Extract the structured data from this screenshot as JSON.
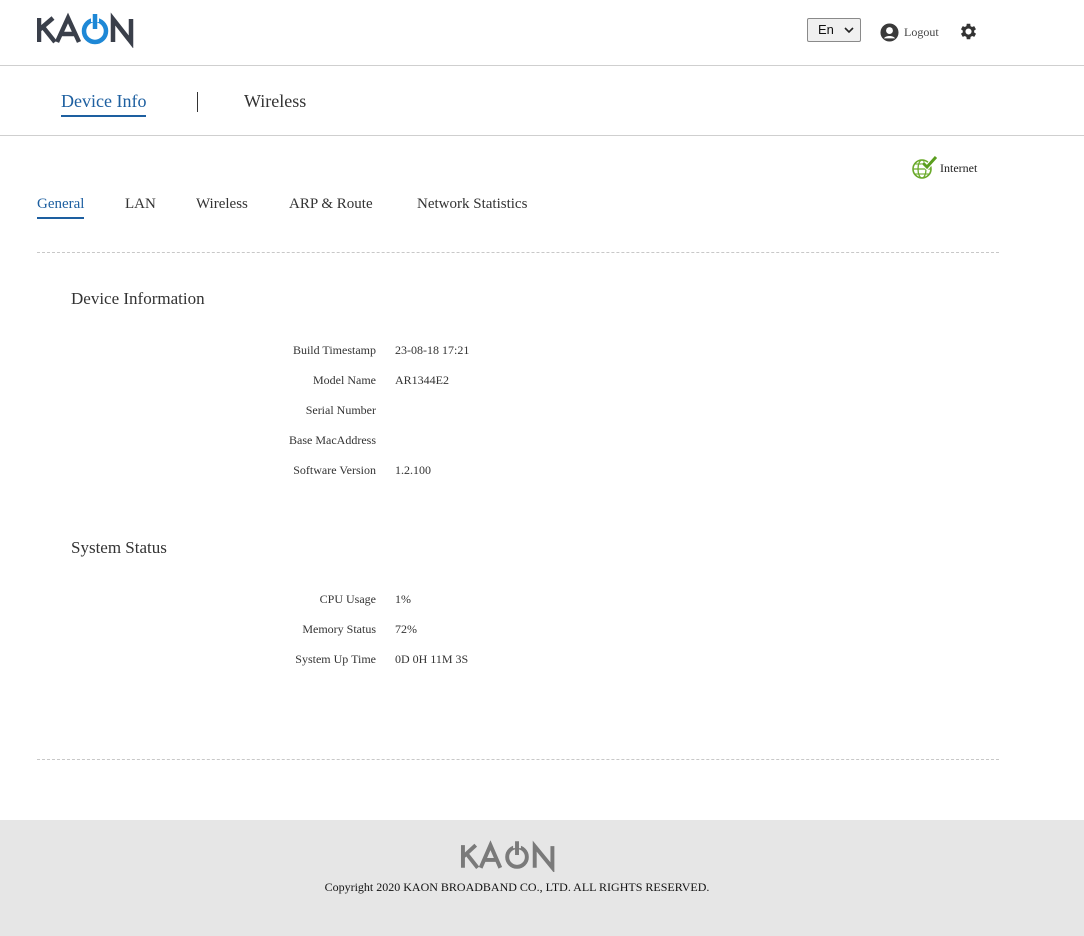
{
  "header": {
    "logo_text": "KAON",
    "language": {
      "selected": "En"
    },
    "logout_label": "Logout"
  },
  "main_tabs": [
    {
      "label": "Device Info",
      "active": true
    },
    {
      "label": "Wireless",
      "active": false
    }
  ],
  "internet_status": {
    "label": "Internet",
    "icon": "globe-check-icon",
    "color": "#6aaa2a"
  },
  "sub_tabs": [
    {
      "label": "General",
      "active": true
    },
    {
      "label": "LAN",
      "active": false
    },
    {
      "label": "Wireless",
      "active": false
    },
    {
      "label": "ARP & Route",
      "active": false
    },
    {
      "label": "Network Statistics",
      "active": false
    }
  ],
  "device_information": {
    "title": "Device Information",
    "rows": [
      {
        "label": "Build Timestamp",
        "value": "23-08-18 17:21"
      },
      {
        "label": "Model Name",
        "value": "AR1344E2"
      },
      {
        "label": "Serial Number",
        "value": ""
      },
      {
        "label": "Base MacAddress",
        "value": ""
      },
      {
        "label": "Software Version",
        "value": "1.2.100"
      }
    ]
  },
  "system_status": {
    "title": "System Status",
    "rows": [
      {
        "label": "CPU Usage",
        "value": "1%"
      },
      {
        "label": "Memory Status",
        "value": "72%"
      },
      {
        "label": "System Up Time",
        "value": "0D 0H 11M 3S"
      }
    ]
  },
  "footer": {
    "logo_text": "KAON",
    "copyright": "Copyright 2020 KAON BROADBAND CO., LTD. ALL RIGHTS RESERVED."
  },
  "colors": {
    "brand_dark": "#3a3f4a",
    "brand_blue": "#1e88d6",
    "active_tab": "#1d5fa0",
    "footer_bg": "#e6e6e6",
    "footer_logo": "#7a7a7a"
  }
}
